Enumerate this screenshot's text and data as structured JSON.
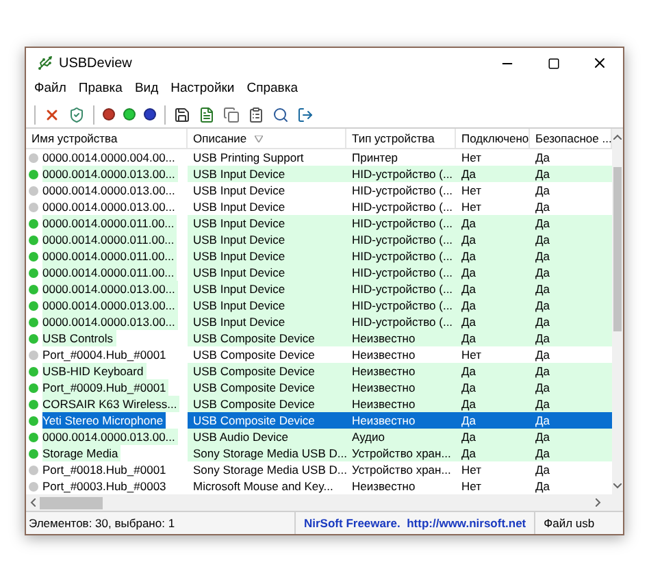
{
  "window": {
    "title": "USBDeview"
  },
  "menu": [
    {
      "label": "Файл"
    },
    {
      "label": "Правка"
    },
    {
      "label": "Вид"
    },
    {
      "label": "Настройки"
    },
    {
      "label": "Справка"
    }
  ],
  "table": {
    "columns": [
      "Имя устройства",
      "Описание",
      "Тип устройства",
      "Подключено",
      "Безопасное ..."
    ],
    "rows": [
      {
        "cells": [
          "0000.0014.0000.004.00...",
          "USB Printing Support",
          "Принтер",
          "Нет",
          "Да"
        ],
        "active": false,
        "selected": false
      },
      {
        "cells": [
          "0000.0014.0000.013.00...",
          "USB Input Device",
          "HID-устройство (...",
          "Да",
          "Да"
        ],
        "active": true,
        "selected": false
      },
      {
        "cells": [
          "0000.0014.0000.013.00...",
          "USB Input Device",
          "HID-устройство (...",
          "Нет",
          "Да"
        ],
        "active": false,
        "selected": false
      },
      {
        "cells": [
          "0000.0014.0000.013.00...",
          "USB Input Device",
          "HID-устройство (...",
          "Нет",
          "Да"
        ],
        "active": false,
        "selected": false
      },
      {
        "cells": [
          "0000.0014.0000.011.00...",
          "USB Input Device",
          "HID-устройство (...",
          "Да",
          "Да"
        ],
        "active": true,
        "selected": false
      },
      {
        "cells": [
          "0000.0014.0000.011.00...",
          "USB Input Device",
          "HID-устройство (...",
          "Да",
          "Да"
        ],
        "active": true,
        "selected": false
      },
      {
        "cells": [
          "0000.0014.0000.011.00...",
          "USB Input Device",
          "HID-устройство (...",
          "Да",
          "Да"
        ],
        "active": true,
        "selected": false
      },
      {
        "cells": [
          "0000.0014.0000.011.00...",
          "USB Input Device",
          "HID-устройство (...",
          "Да",
          "Да"
        ],
        "active": true,
        "selected": false
      },
      {
        "cells": [
          "0000.0014.0000.013.00...",
          "USB Input Device",
          "HID-устройство (...",
          "Да",
          "Да"
        ],
        "active": true,
        "selected": false
      },
      {
        "cells": [
          "0000.0014.0000.013.00...",
          "USB Input Device",
          "HID-устройство (...",
          "Да",
          "Да"
        ],
        "active": true,
        "selected": false
      },
      {
        "cells": [
          "0000.0014.0000.013.00...",
          "USB Input Device",
          "HID-устройство (...",
          "Да",
          "Да"
        ],
        "active": true,
        "selected": false
      },
      {
        "cells": [
          "USB Controls",
          "USB Composite Device",
          "Неизвестно",
          "Да",
          "Да"
        ],
        "active": true,
        "selected": false
      },
      {
        "cells": [
          "Port_#0004.Hub_#0001",
          "USB Composite Device",
          "Неизвестно",
          "Нет",
          "Да"
        ],
        "active": false,
        "selected": false
      },
      {
        "cells": [
          "USB-HID Keyboard",
          "USB Composite Device",
          "Неизвестно",
          "Да",
          "Да"
        ],
        "active": true,
        "selected": false
      },
      {
        "cells": [
          "Port_#0009.Hub_#0001",
          "USB Composite Device",
          "Неизвестно",
          "Да",
          "Да"
        ],
        "active": true,
        "selected": false
      },
      {
        "cells": [
          "CORSAIR K63 Wireless...",
          "USB Composite Device",
          "Неизвестно",
          "Да",
          "Да"
        ],
        "active": true,
        "selected": false
      },
      {
        "cells": [
          "Yeti Stereo Microphone",
          "USB Composite Device",
          "Неизвестно",
          "Да",
          "Да"
        ],
        "active": true,
        "selected": true
      },
      {
        "cells": [
          "0000.0014.0000.013.00...",
          "USB Audio Device",
          "Аудио",
          "Да",
          "Да"
        ],
        "active": true,
        "selected": false
      },
      {
        "cells": [
          "Storage Media",
          "Sony Storage Media USB D...",
          "Устройство хран...",
          "Да",
          "Да"
        ],
        "active": true,
        "selected": false
      },
      {
        "cells": [
          "Port_#0018.Hub_#0001",
          "Sony Storage Media USB D...",
          "Устройство хран...",
          "Нет",
          "Да"
        ],
        "active": false,
        "selected": false
      },
      {
        "cells": [
          "Port_#0003.Hub_#0003",
          "Microsoft Mouse and Key...",
          "Неизвестно",
          "Нет",
          "Да"
        ],
        "active": false,
        "selected": false
      }
    ]
  },
  "status_bar": {
    "count": "Элементов: 30, выбрано: 1",
    "link": "NirSoft Freeware.  http://www.nirsoft.net",
    "file": "Файл usb"
  }
}
